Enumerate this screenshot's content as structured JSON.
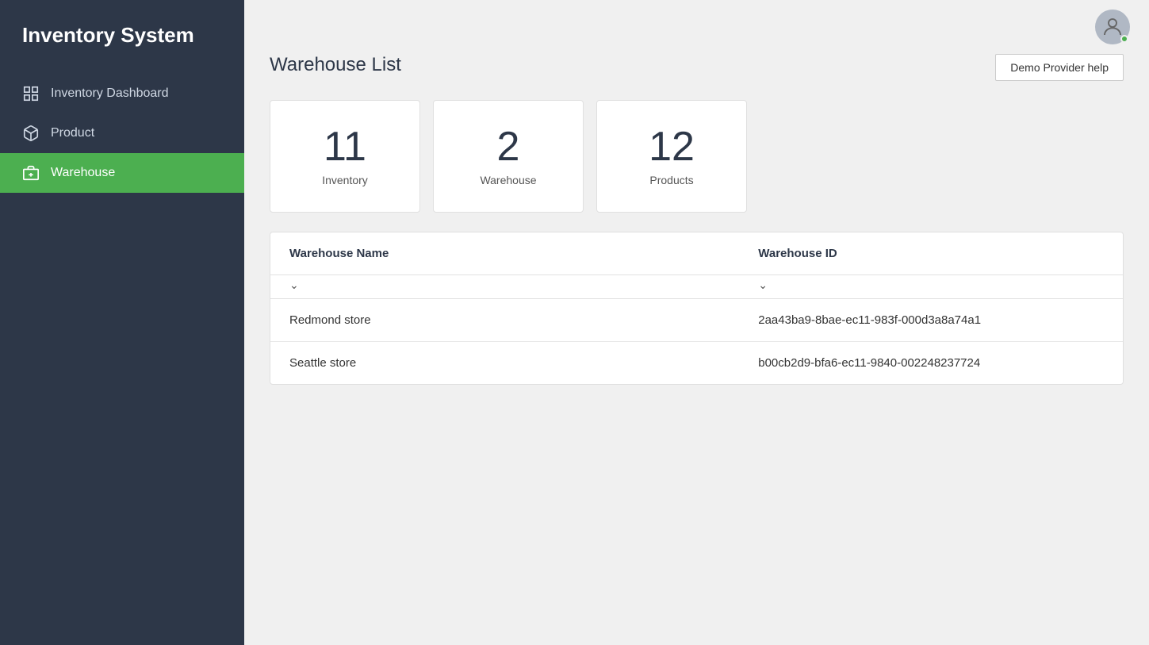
{
  "app": {
    "title": "Inventory System"
  },
  "sidebar": {
    "items": [
      {
        "id": "inventory-dashboard",
        "label": "Inventory Dashboard",
        "icon": "grid-icon",
        "active": false
      },
      {
        "id": "product",
        "label": "Product",
        "icon": "box-icon",
        "active": false
      },
      {
        "id": "warehouse",
        "label": "Warehouse",
        "icon": "warehouse-icon",
        "active": true
      }
    ]
  },
  "topbar": {
    "avatar_alt": "User avatar"
  },
  "page": {
    "title": "Warehouse List",
    "help_button": "Demo Provider help"
  },
  "stats": [
    {
      "number": "11",
      "label": "Inventory"
    },
    {
      "number": "2",
      "label": "Warehouse"
    },
    {
      "number": "12",
      "label": "Products"
    }
  ],
  "table": {
    "columns": [
      {
        "key": "name",
        "label": "Warehouse Name"
      },
      {
        "key": "id",
        "label": "Warehouse ID"
      }
    ],
    "rows": [
      {
        "name": "Redmond store",
        "id": "2aa43ba9-8bae-ec11-983f-000d3a8a74a1"
      },
      {
        "name": "Seattle store",
        "id": "b00cb2d9-bfa6-ec11-9840-002248237724"
      }
    ]
  }
}
